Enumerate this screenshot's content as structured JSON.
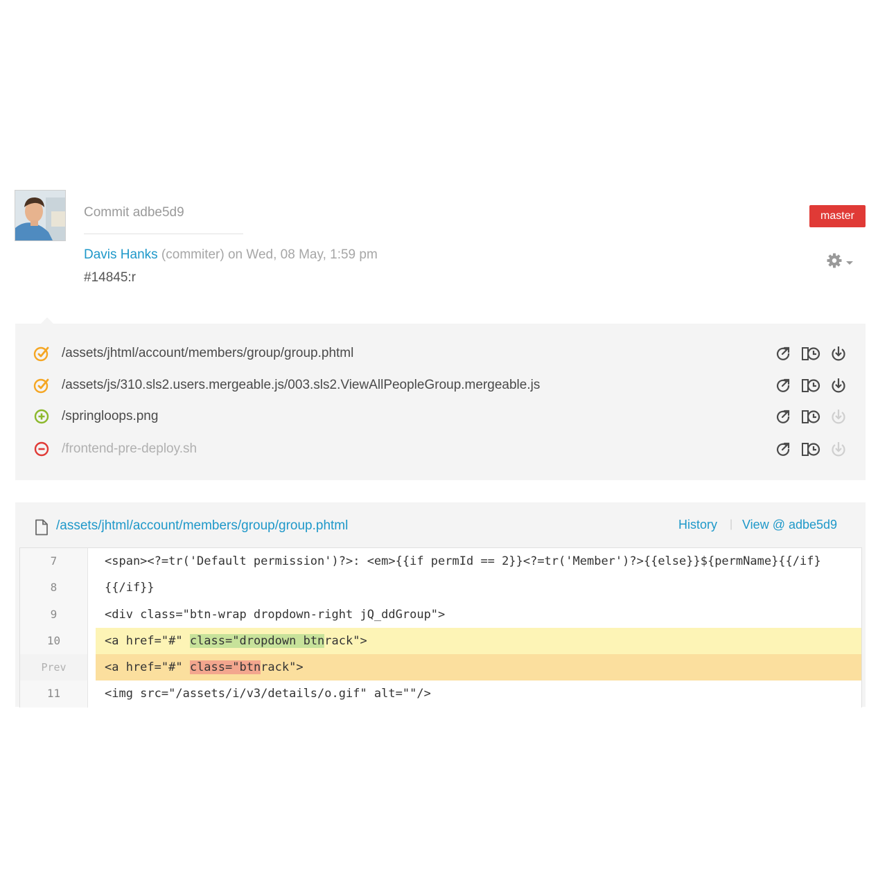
{
  "commit": {
    "title": "Commit adbe5d9",
    "author": "Davis Hanks",
    "meta": " (commiter) on Wed, 08 May, 1:59 pm",
    "message": "#14845:r",
    "branch": "master"
  },
  "files": [
    {
      "status": "modified",
      "path": "/assets/jhtml/account/members/group/group.phtml"
    },
    {
      "status": "modified",
      "path": "/assets/js/310.sls2.users.mergeable.js/003.sls2.ViewAllPeopleGroup.mergeable.js"
    },
    {
      "status": "added",
      "path": "/springloops.png"
    },
    {
      "status": "deleted",
      "path": "/frontend-pre-deploy.sh"
    }
  ],
  "status_colors": {
    "modified": "#f5a623",
    "added": "#8cb82b",
    "deleted": "#e03a36"
  },
  "diff": {
    "path": "/assets/jhtml/account/members/group/group.phtml",
    "history_label": "History",
    "separator": "|",
    "view_label": "View @ adbe5d9",
    "lines": [
      {
        "num": "7",
        "type": "context",
        "pre": "<span><?=tr('Default permission')?>: <em>{{if permId == 2}}<?=tr('Member')?>{{else}}${permName}{{/if}",
        "mark": "",
        "post": ""
      },
      {
        "num": "8",
        "type": "context",
        "pre": "{{/if}}",
        "mark": "",
        "post": ""
      },
      {
        "num": "9",
        "type": "context",
        "pre": "<div class=\"btn-wrap dropdown-right jQ_ddGroup\">",
        "mark": "",
        "post": ""
      },
      {
        "num": "10",
        "type": "added",
        "pre": "<a href=\"#\" ",
        "mark": "class=\"dropdown btn",
        "post": "rack\">"
      },
      {
        "num": "Prev",
        "type": "removed",
        "pre": "<a href=\"#\" ",
        "mark": "class=\"btn",
        "post": "rack\">"
      },
      {
        "num": "11",
        "type": "context",
        "pre": "<img src=\"/assets/i/v3/details/o.gif\" alt=\"\"/>",
        "mark": "",
        "post": ""
      }
    ]
  }
}
